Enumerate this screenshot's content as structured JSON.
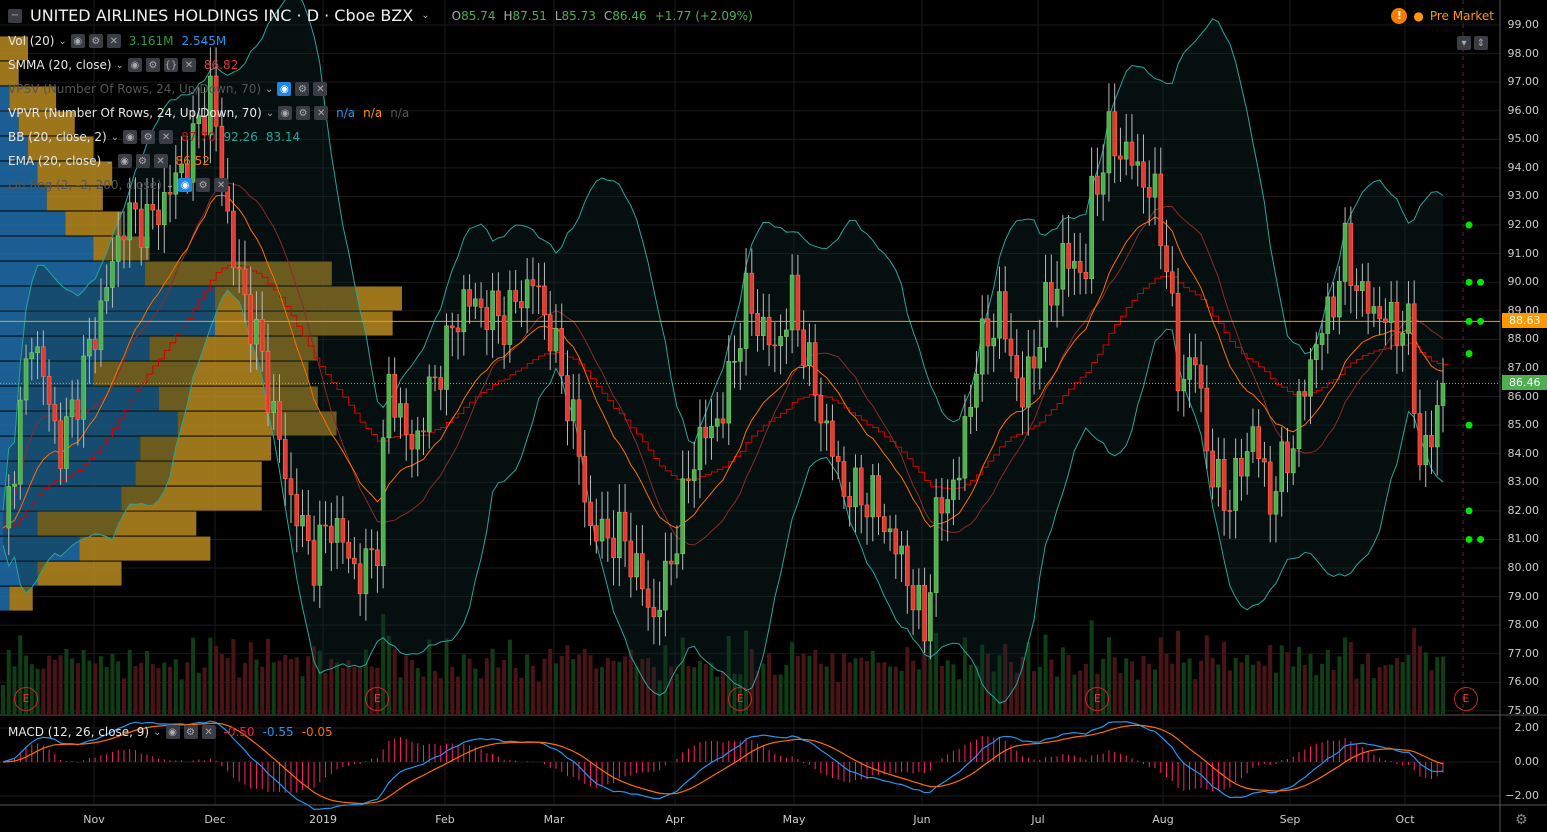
{
  "header": {
    "symbol_name": "UNITED AIRLINES HOLDINGS INC · D · Cboe BZX",
    "open_label": "O",
    "open": "85.74",
    "high_label": "H",
    "high": "87.51",
    "low_label": "L",
    "low": "85.73",
    "close_label": "C",
    "close": "86.46",
    "change": "+1.77 (+2.09%)",
    "pre_market": "Pre Market"
  },
  "indicators": [
    {
      "label": "Vol (20)",
      "values": [
        "3.161M",
        "2.545M"
      ],
      "colors": [
        "#2e9e36",
        "#2196f3"
      ]
    },
    {
      "label": "SMMA (20, close)",
      "values": [
        "86.82"
      ],
      "colors": [
        "#e53935"
      ]
    },
    {
      "label": "VPSV (Number Of Rows, 24, Up/Down, 70)",
      "values": [],
      "colors": []
    },
    {
      "label": "VPVR (Number Of Rows, 24, Up/Down, 70)",
      "values": [
        "n/a",
        "n/a",
        "n/a"
      ],
      "colors": [
        "#2196f3",
        "#ff9800",
        "#555"
      ]
    },
    {
      "label": "BB (20, close, 2)",
      "values": [
        "87.70",
        "92.26",
        "83.14"
      ],
      "colors": [
        "#b71c1c",
        "#26a69a",
        "#26a69a"
      ]
    },
    {
      "label": "EMA (20, close)",
      "values": [
        "86.52"
      ],
      "colors": [
        "#ff6d00"
      ]
    },
    {
      "label": "Lin Reg (2, -2, 200, close)",
      "values": [],
      "colors": []
    }
  ],
  "macd": {
    "label": "MACD (12, 26, close, 9)",
    "values": [
      "-0.50",
      "-0.55",
      "-0.05"
    ],
    "colors": [
      "#ff1744",
      "#2196f3",
      "#ff6d00"
    ]
  },
  "price_axis": [
    "99.00",
    "98.00",
    "97.00",
    "96.00",
    "95.00",
    "94.00",
    "93.00",
    "92.00",
    "91.00",
    "90.00",
    "89.00",
    "88.00",
    "87.00",
    "86.00",
    "85.00",
    "84.00",
    "83.00",
    "82.00",
    "81.00",
    "80.00",
    "79.00",
    "78.00",
    "77.00",
    "76.00",
    "75.00"
  ],
  "macd_axis": [
    "2.00",
    "0.00",
    "−2.00"
  ],
  "price_tags": {
    "line": "88.63",
    "last": "86.46"
  },
  "time_axis": [
    "Nov",
    "Dec",
    "2019",
    "Feb",
    "Mar",
    "Apr",
    "May",
    "Jun",
    "Jul",
    "Aug",
    "Sep",
    "Oct"
  ],
  "earnings_marker": "E",
  "colors": {
    "up": "#4caf50",
    "down": "#e53935",
    "bb": "#26a69a",
    "ema": "#ff6d00",
    "smma": "#d50000",
    "orange_line": "#ff9800",
    "vp_up": "#1f6fae",
    "vp_down": "#b8891f"
  },
  "chart_data": {
    "type": "candlestick",
    "title": "UNITED AIRLINES HOLDINGS INC · D",
    "ylim": [
      75,
      99
    ],
    "key_days": [
      0,
      5,
      10,
      16,
      21,
      26,
      32,
      36,
      40,
      45,
      50,
      54,
      57,
      62,
      65,
      67,
      71,
      75,
      80,
      87,
      92,
      95,
      99,
      102,
      108,
      113,
      116,
      120,
      125,
      129,
      134,
      137,
      141,
      146,
      151,
      156,
      160,
      162,
      166,
      169,
      173,
      177,
      181,
      184,
      188,
      189,
      192,
      196,
      200,
      202,
      204,
      207,
      210,
      213,
      217,
      220,
      224,
      227,
      231,
      233,
      236,
      240,
      244,
      246,
      248,
      250
    ],
    "key_closes": [
      81,
      88.3,
      84.1,
      88.3,
      92.2,
      92.2,
      94.3,
      96.7,
      90.8,
      87.3,
      82.4,
      80.3,
      81.7,
      79.6,
      81,
      86.6,
      84.1,
      86.6,
      89.4,
      88.7,
      90.1,
      88.3,
      85.2,
      81.3,
      81,
      78.2,
      80.3,
      84.1,
      85.5,
      89.4,
      87.6,
      89.4,
      86.2,
      82.7,
      82.4,
      80.3,
      77.8,
      81.7,
      83.4,
      87.3,
      89,
      85.9,
      89,
      90.8,
      90.4,
      92.9,
      95,
      94.3,
      92.9,
      90.8,
      86.6,
      87.3,
      83.1,
      82.4,
      84.8,
      82.4,
      84.5,
      87.3,
      89.4,
      91.1,
      89.4,
      88.7,
      88.3,
      83.8,
      84.5,
      86.46
    ],
    "volume_profile": {
      "price_high": 98.6,
      "row_size": 0.875,
      "rows": [
        [
          0,
          30
        ],
        [
          0,
          20
        ],
        [
          10,
          50
        ],
        [
          20,
          60
        ],
        [
          30,
          70
        ],
        [
          40,
          80
        ],
        [
          50,
          60
        ],
        [
          70,
          60
        ],
        [
          100,
          60
        ],
        [
          155,
          200
        ],
        [
          230,
          200
        ],
        [
          230,
          190
        ],
        [
          160,
          180
        ],
        [
          100,
          230
        ],
        [
          170,
          170
        ],
        [
          190,
          170
        ],
        [
          150,
          140
        ],
        [
          145,
          135
        ],
        [
          130,
          150
        ],
        [
          40,
          170
        ],
        [
          85,
          140
        ],
        [
          40,
          90
        ],
        [
          10,
          25
        ]
      ]
    },
    "earnings_days": [
      4,
      65,
      128,
      190,
      254
    ],
    "signal_dots": [
      [
        254,
        92
      ],
      [
        254,
        90
      ],
      [
        256,
        90
      ],
      [
        254,
        88.63
      ],
      [
        256,
        88.63
      ],
      [
        254,
        87.5
      ],
      [
        254,
        85
      ],
      [
        254,
        82
      ],
      [
        254,
        81
      ],
      [
        256,
        81
      ]
    ]
  }
}
